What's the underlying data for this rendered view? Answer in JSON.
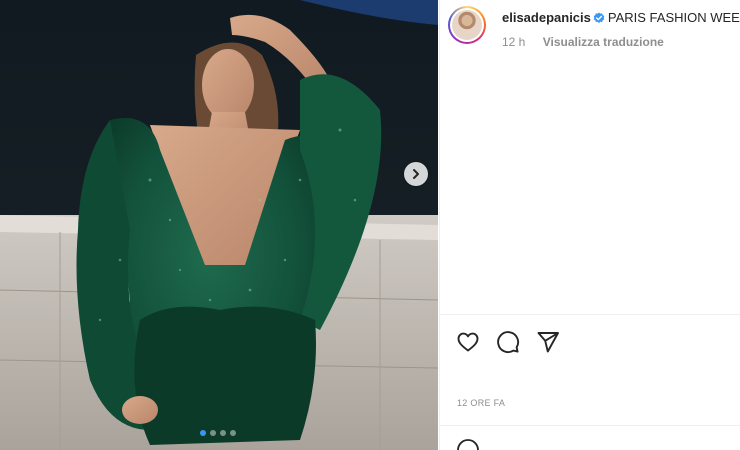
{
  "post": {
    "username": "elisadepanicis",
    "caption": "PARIS FASHION WEEK",
    "time_ago": "12 h",
    "translate_label": "Visualizza traduzione",
    "date_label": "12 ORE FA",
    "verified": true
  },
  "carousel": {
    "slide_count": 4,
    "active_index": 0
  },
  "icons": {
    "next": "chevron-right-icon",
    "like": "heart-icon",
    "comment": "comment-icon",
    "share": "paper-plane-icon",
    "emoji": "emoji-icon"
  },
  "colors": {
    "verified": "#3897f0",
    "dress": "#0f4a34",
    "muted_text": "#8e8e8e"
  }
}
